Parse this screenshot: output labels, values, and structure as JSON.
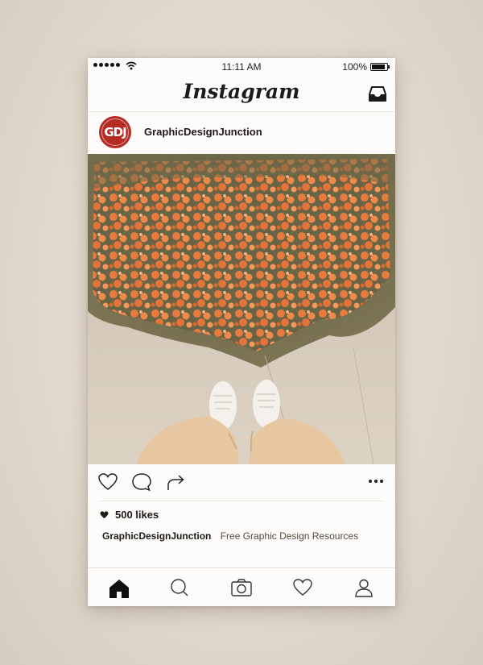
{
  "status_bar": {
    "time": "11:11 AM",
    "battery": "100%"
  },
  "header": {
    "app_title": "Instagram"
  },
  "post": {
    "avatar_text": "GDJ",
    "username": "GraphicDesignJunction",
    "likes": "500 likes",
    "caption_user": "GraphicDesignJunction",
    "caption_text": "Free Graphic Design Resources"
  },
  "icons": {
    "top": [
      "inbox-icon"
    ],
    "actions": [
      "heart-icon",
      "comment-icon",
      "share-icon",
      "more-options-icon"
    ],
    "tabs": [
      "home-icon",
      "search-icon",
      "camera-icon",
      "activity-heart-icon",
      "profile-icon"
    ]
  },
  "colors": {
    "avatar_red": "#b62a24",
    "background": "#e6ded3",
    "card": "#fdfcfa"
  }
}
